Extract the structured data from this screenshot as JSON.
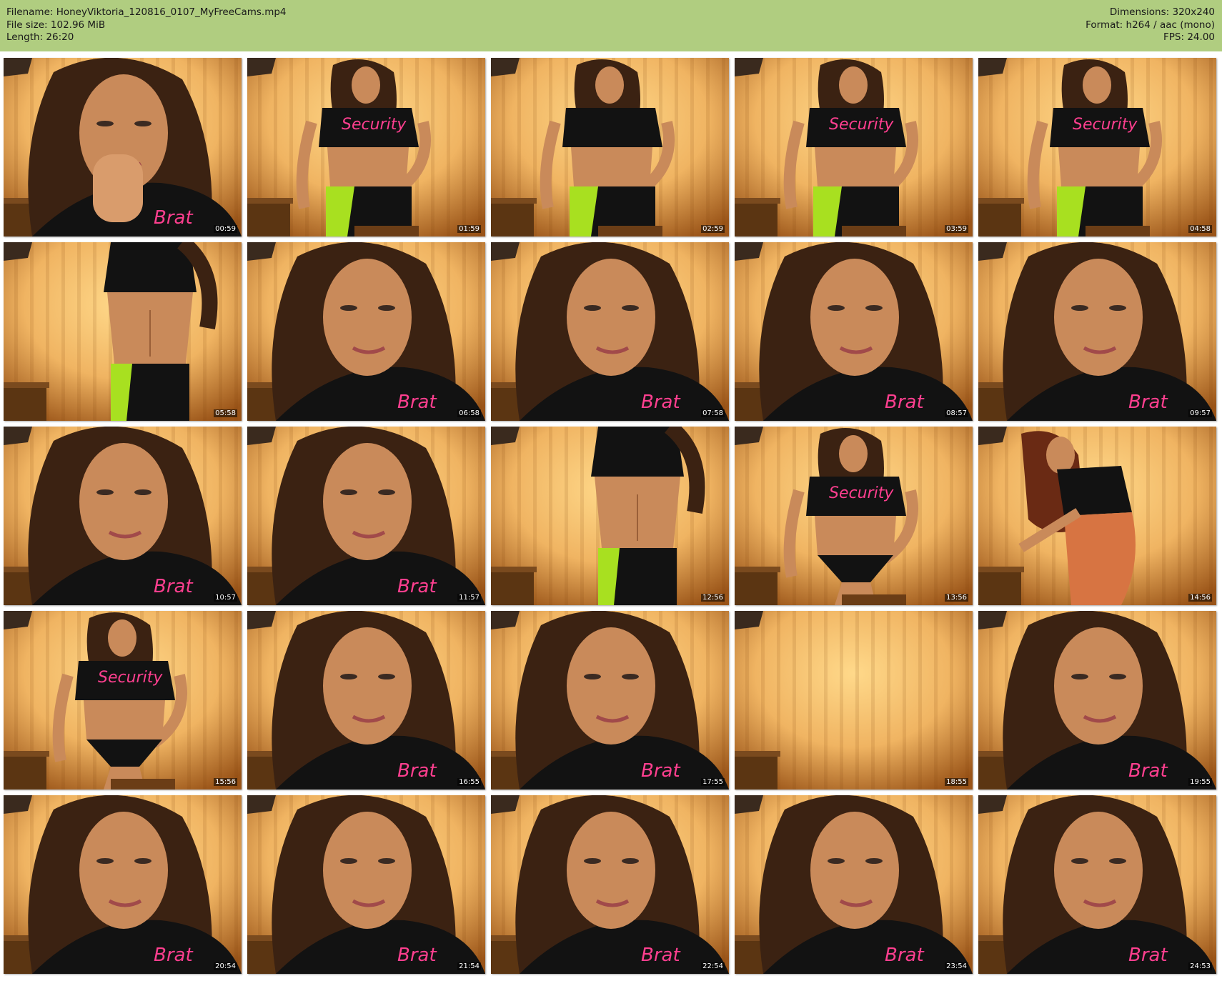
{
  "header": {
    "filename": "Filename: HoneyViktoria_120816_0107_MyFreeCams.mp4",
    "filesize": "File size: 102.96 MiB",
    "length": "Length: 26:20",
    "dimensions": "Dimensions: 320x240",
    "format": "Format: h264 / aac (mono)",
    "fps": "FPS: 24.00"
  },
  "colors": {
    "header_bg": "#b0cd80",
    "wall": "#f0b462",
    "wall_dark": "#9a5418",
    "hair": "#3b2212",
    "skin": "#c98a5a",
    "shirt": "#121212",
    "pants_accent": "#a8e020",
    "logo_pink": "#ff3f8f"
  },
  "thumbnails": [
    {
      "time": "00:59",
      "scene": "closeup-kiss"
    },
    {
      "time": "01:59",
      "scene": "standing"
    },
    {
      "time": "02:59",
      "scene": "turned"
    },
    {
      "time": "03:59",
      "scene": "standing"
    },
    {
      "time": "04:58",
      "scene": "standing"
    },
    {
      "time": "05:58",
      "scene": "torso"
    },
    {
      "time": "06:58",
      "scene": "closeup"
    },
    {
      "time": "07:58",
      "scene": "closeup"
    },
    {
      "time": "08:57",
      "scene": "closeup"
    },
    {
      "time": "09:57",
      "scene": "closeup"
    },
    {
      "time": "10:57",
      "scene": "closeup"
    },
    {
      "time": "11:57",
      "scene": "closeup"
    },
    {
      "time": "12:56",
      "scene": "torso"
    },
    {
      "time": "13:56",
      "scene": "standing-briefs"
    },
    {
      "time": "14:56",
      "scene": "turned-back"
    },
    {
      "time": "15:56",
      "scene": "standing-briefs"
    },
    {
      "time": "16:55",
      "scene": "closeup"
    },
    {
      "time": "17:55",
      "scene": "closeup"
    },
    {
      "time": "18:55",
      "scene": "empty"
    },
    {
      "time": "19:55",
      "scene": "closeup"
    },
    {
      "time": "20:54",
      "scene": "closeup"
    },
    {
      "time": "21:54",
      "scene": "closeup"
    },
    {
      "time": "22:54",
      "scene": "closeup"
    },
    {
      "time": "23:54",
      "scene": "closeup"
    },
    {
      "time": "24:53",
      "scene": "closeup"
    }
  ]
}
